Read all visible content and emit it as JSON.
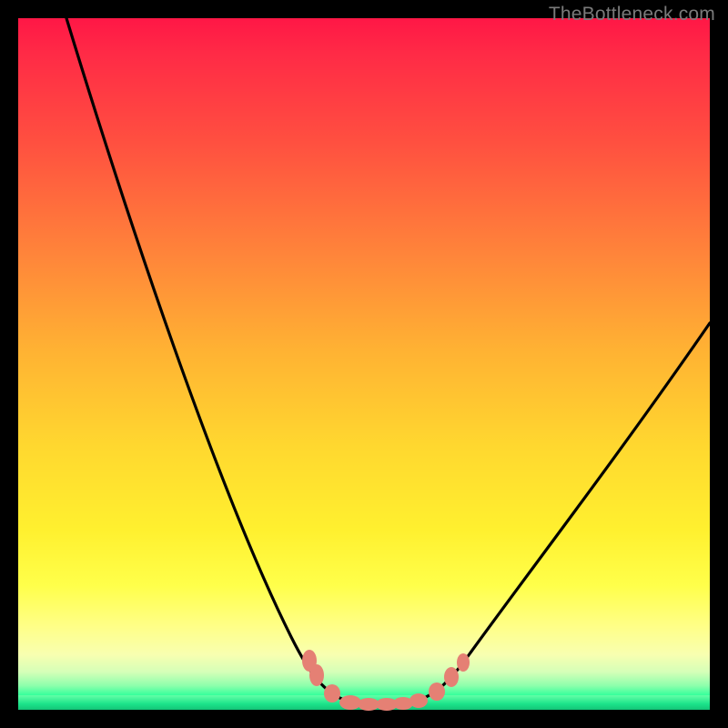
{
  "watermark": "TheBottleneck.com",
  "colors": {
    "frame": "#000000",
    "curve": "#000000",
    "marker": "#e58074",
    "gradient_top": "#ff1746",
    "gradient_bottom": "#17d07e"
  },
  "chart_data": {
    "type": "line",
    "title": "",
    "xlabel": "",
    "ylabel": "",
    "xlim": [
      0,
      100
    ],
    "ylim": [
      0,
      100
    ],
    "grid": false,
    "legend": false,
    "note": "Axes have no visible tick labels; values are normalized 0–100 estimates read from pixel positions. y=0 is the bottom green band (best / no bottleneck), y=100 is top.",
    "series": [
      {
        "name": "left-branch",
        "x": [
          7,
          12,
          17,
          22,
          27,
          32,
          36,
          40,
          43,
          45,
          47
        ],
        "y": [
          100,
          85,
          70,
          55,
          41,
          28,
          17,
          9,
          4,
          2,
          1
        ]
      },
      {
        "name": "valley-floor",
        "x": [
          47,
          50,
          53,
          56,
          59
        ],
        "y": [
          1,
          0.5,
          0.5,
          0.5,
          1
        ]
      },
      {
        "name": "right-branch",
        "x": [
          59,
          62,
          66,
          71,
          77,
          84,
          92,
          100
        ],
        "y": [
          1,
          3,
          7,
          13,
          21,
          31,
          43,
          56
        ]
      }
    ],
    "markers": {
      "name": "highlight-dots",
      "note": "Salmon/coral dots clustered near the valley bottom on both sides.",
      "points": [
        {
          "x": 42.5,
          "y": 6
        },
        {
          "x": 43.5,
          "y": 4
        },
        {
          "x": 45.5,
          "y": 2
        },
        {
          "x": 48,
          "y": 0.7
        },
        {
          "x": 50,
          "y": 0.5
        },
        {
          "x": 52,
          "y": 0.5
        },
        {
          "x": 54,
          "y": 0.5
        },
        {
          "x": 56,
          "y": 0.6
        },
        {
          "x": 58,
          "y": 1.0
        },
        {
          "x": 60.5,
          "y": 2.0
        },
        {
          "x": 62.5,
          "y": 4.0
        },
        {
          "x": 64.5,
          "y": 6.5
        }
      ]
    }
  }
}
